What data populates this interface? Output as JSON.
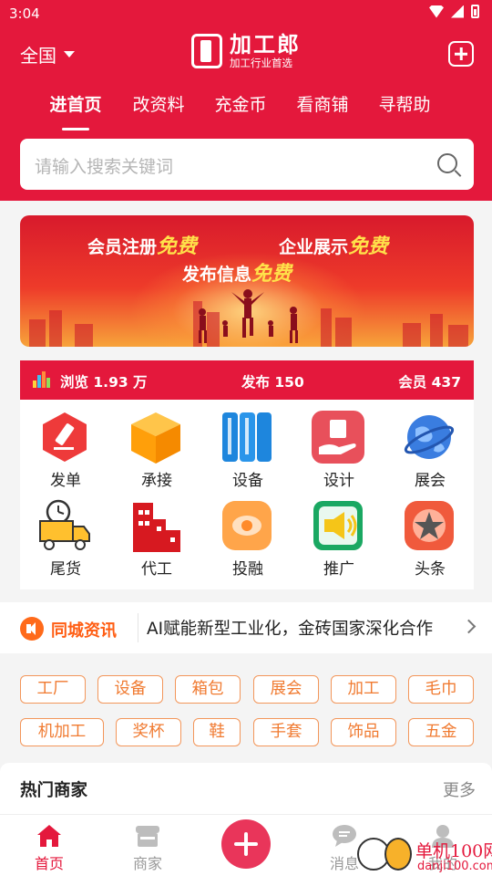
{
  "status": {
    "time": "3:04"
  },
  "header": {
    "region": "全国",
    "brand_name": "加工郎",
    "brand_slogan": "加工行业首选",
    "tabs": [
      {
        "label": "进首页",
        "active": true
      },
      {
        "label": "改资料",
        "active": false
      },
      {
        "label": "充金币",
        "active": false
      },
      {
        "label": "看商铺",
        "active": false
      },
      {
        "label": "寻帮助",
        "active": false
      }
    ],
    "search_placeholder": "请输入搜索关键词"
  },
  "banner": {
    "line1_text": "会员注册",
    "line1_highlight": "免费",
    "line2_text": "企业展示",
    "line2_highlight": "免费",
    "line3_text": "发布信息",
    "line3_highlight": "免费"
  },
  "stats": {
    "views": "浏览 1.93 万",
    "posts": "发布 150",
    "members": "会员 437"
  },
  "grid": [
    {
      "label": "发单",
      "icon": "order-icon",
      "color": "#ee3a3a"
    },
    {
      "label": "承接",
      "icon": "box-icon",
      "color": "#ffa20a"
    },
    {
      "label": "设备",
      "icon": "equipment-icon",
      "color": "#1e86dd"
    },
    {
      "label": "设计",
      "icon": "design-icon",
      "color": "#e8505b"
    },
    {
      "label": "展会",
      "icon": "globe-icon",
      "color": "#3a7de0"
    },
    {
      "label": "尾货",
      "icon": "truck-icon",
      "color": "#ffc02e"
    },
    {
      "label": "代工",
      "icon": "factory-icon",
      "color": "#d71920"
    },
    {
      "label": "投融",
      "icon": "invest-icon",
      "color": "#ffa54a"
    },
    {
      "label": "推广",
      "icon": "promote-icon",
      "color": "#1aa862"
    },
    {
      "label": "头条",
      "icon": "star-icon",
      "color": "#f05a3c"
    }
  ],
  "notice": {
    "title": "同城资讯",
    "text": "AI赋能新型工业化，金砖国家深化合作"
  },
  "tags": [
    "工厂",
    "设备",
    "箱包",
    "展会",
    "加工",
    "毛巾",
    "机加工",
    "奖杯",
    "鞋",
    "手套",
    "饰品",
    "五金"
  ],
  "hot": {
    "title": "热门商家",
    "more": "更多"
  },
  "nav": [
    {
      "label": "首页",
      "active": true
    },
    {
      "label": "商家",
      "active": false
    },
    {
      "label": "消息",
      "active": false
    },
    {
      "label": "我的",
      "active": false
    }
  ],
  "watermark": {
    "line1": "单机100网",
    "line2": "danji100.com"
  },
  "colors": {
    "brand": "#e4183c",
    "accent_orange": "#f07a30"
  }
}
